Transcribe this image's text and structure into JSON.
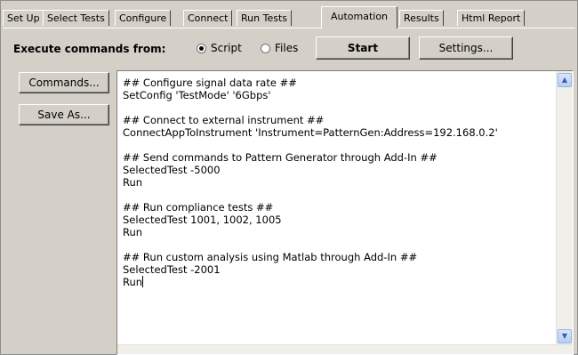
{
  "tabs": [
    {
      "label": "Set Up"
    },
    {
      "label": "Select Tests"
    },
    {
      "label": "Configure"
    },
    {
      "label": "Connect"
    },
    {
      "label": "Run Tests"
    },
    {
      "label": "Automation",
      "active": true
    },
    {
      "label": "Results"
    },
    {
      "label": "Html Report"
    }
  ],
  "execute": {
    "label": "Execute commands from:",
    "options": [
      {
        "label": "Script",
        "checked": true
      },
      {
        "label": "Files",
        "checked": false
      }
    ],
    "start_label": "Start",
    "settings_label": "Settings..."
  },
  "sidebar": {
    "commands_label": "Commands...",
    "saveas_label": "Save As..."
  },
  "editor": {
    "lines": [
      "## Configure signal data rate ##",
      "SetConfig 'TestMode' '6Gbps'",
      "",
      "## Connect to external instrument ##",
      "ConnectAppToInstrument 'Instrument=PatternGen:Address=192.168.0.2'",
      "",
      "## Send commands to Pattern Generator through Add-In ##",
      "SelectedTest -5000",
      "Run",
      "",
      "## Run compliance tests ##",
      "SelectedTest 1001, 1002, 1005",
      "Run",
      "",
      "## Run custom analysis using Matlab through Add-In ##",
      "SelectedTest -2001",
      "Run"
    ]
  },
  "icons": {
    "scroll_up": "chevron-up-icon",
    "scroll_down": "chevron-down-icon"
  }
}
